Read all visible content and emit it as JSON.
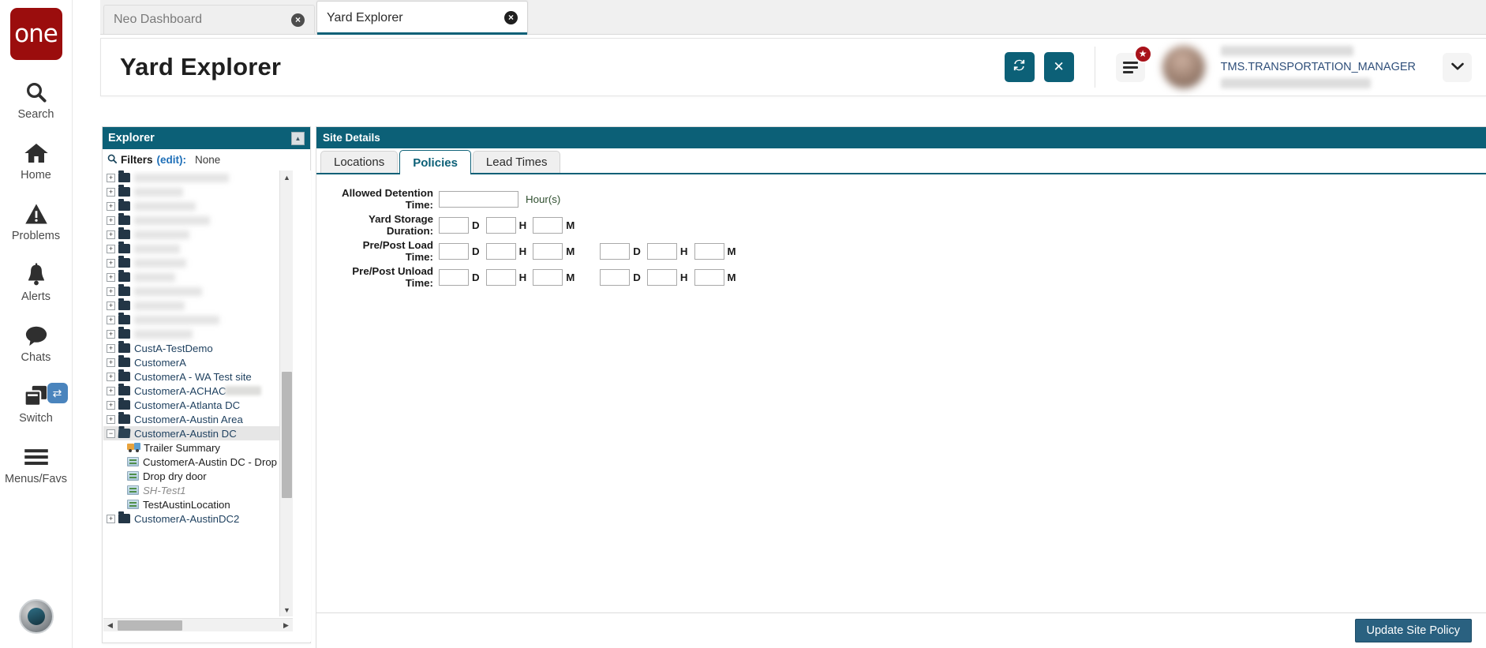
{
  "rail": {
    "logo_text": "one",
    "items": [
      {
        "label": "Search",
        "icon": "search-icon"
      },
      {
        "label": "Home",
        "icon": "home-icon"
      },
      {
        "label": "Problems",
        "icon": "warning-triangle-icon"
      },
      {
        "label": "Alerts",
        "icon": "bell-icon"
      },
      {
        "label": "Chats",
        "icon": "chat-bubble-icon"
      },
      {
        "label": "Switch",
        "icon": "switch-windows-icon",
        "badge_icon": "swap-arrows-icon"
      },
      {
        "label": "Menus/Favs",
        "icon": "hamburger-icon"
      }
    ]
  },
  "browser_tabs": [
    {
      "label": "Neo Dashboard",
      "active": false,
      "close_icon": "close-circle-icon"
    },
    {
      "label": "Yard Explorer",
      "active": true,
      "close_icon": "close-circle-icon"
    }
  ],
  "header": {
    "title": "Yard Explorer",
    "refresh_icon": "refresh-icon",
    "close_icon": "close-x-icon",
    "menu_icon": "hamburger-menu-icon",
    "star_badge_icon": "star-icon",
    "user_role": "TMS.TRANSPORTATION_MANAGER",
    "caret_icon": "chevron-down-icon",
    "accent_color": "#0c6077"
  },
  "explorer": {
    "title": "Explorer",
    "collapse_icon": "collapse-up-icon",
    "search_icon": "search-icon",
    "filters_label": "Filters",
    "filters_edit": "(edit):",
    "filters_value": "None",
    "tree": [
      {
        "label": "",
        "type": "folder",
        "state": "collapsed",
        "redacted": true,
        "redact_width": 120
      },
      {
        "label": "",
        "type": "folder",
        "state": "collapsed",
        "redacted": true,
        "redact_width": 62
      },
      {
        "label": "",
        "type": "folder",
        "state": "collapsed",
        "redacted": true,
        "redact_width": 78
      },
      {
        "label": "",
        "type": "folder",
        "state": "collapsed",
        "redacted": true,
        "redact_width": 96
      },
      {
        "label": "",
        "type": "folder",
        "state": "collapsed",
        "redacted": true,
        "redact_width": 70
      },
      {
        "label": "",
        "type": "folder",
        "state": "collapsed",
        "redacted": true,
        "redact_width": 58
      },
      {
        "label": "",
        "type": "folder",
        "state": "collapsed",
        "redacted": true,
        "redact_width": 66
      },
      {
        "label": "",
        "type": "folder",
        "state": "collapsed",
        "redacted": true,
        "redact_width": 52
      },
      {
        "label": "",
        "type": "folder",
        "state": "collapsed",
        "redacted": true,
        "redact_width": 86
      },
      {
        "label": "",
        "type": "folder",
        "state": "collapsed",
        "redacted": true,
        "redact_width": 64
      },
      {
        "label": "",
        "type": "folder",
        "state": "collapsed",
        "redacted": true,
        "redact_width": 108
      },
      {
        "label": "",
        "type": "folder",
        "state": "collapsed",
        "redacted": true,
        "redact_width": 74
      },
      {
        "label": "CustA-TestDemo",
        "type": "folder",
        "state": "collapsed"
      },
      {
        "label": "CustomerA",
        "type": "folder",
        "state": "collapsed"
      },
      {
        "label": "CustomerA - WA Test site",
        "type": "folder",
        "state": "collapsed"
      },
      {
        "label": "CustomerA-ACHAC",
        "type": "folder",
        "state": "collapsed",
        "partial_redact": true
      },
      {
        "label": "CustomerA-Atlanta DC",
        "type": "folder",
        "state": "collapsed"
      },
      {
        "label": "CustomerA-Austin Area",
        "type": "folder",
        "state": "collapsed"
      },
      {
        "label": "CustomerA-Austin DC",
        "type": "folder",
        "state": "expanded",
        "selected": true
      },
      {
        "label": "Trailer Summary",
        "type": "trailer",
        "child": true
      },
      {
        "label": "CustomerA-Austin DC - Drop",
        "type": "location",
        "child": true
      },
      {
        "label": "Drop dry door",
        "type": "location",
        "child": true
      },
      {
        "label": "SH-Test1",
        "type": "location",
        "child": true,
        "inactive": true
      },
      {
        "label": "TestAustinLocation",
        "type": "location",
        "child": true
      },
      {
        "label": "CustomerA-AustinDC2",
        "type": "folder",
        "state": "collapsed"
      }
    ],
    "scroll_up_icon": "triangle-up-icon",
    "scroll_down_icon": "triangle-down-icon",
    "scroll_left_icon": "triangle-left-icon",
    "scroll_right_icon": "triangle-right-icon"
  },
  "details": {
    "title": "Site Details",
    "tabs": [
      {
        "label": "Locations",
        "active": false
      },
      {
        "label": "Policies",
        "active": true
      },
      {
        "label": "Lead Times",
        "active": false
      }
    ],
    "form": {
      "allowed_detention": {
        "label": "Allowed Detention Time:",
        "value": "",
        "unit": "Hour(s)"
      },
      "yard_storage": {
        "label": "Yard Storage Duration:",
        "fields": [
          {
            "value": "",
            "unit": "D"
          },
          {
            "value": "",
            "unit": "H"
          },
          {
            "value": "",
            "unit": "M"
          }
        ]
      },
      "pre_post_load": {
        "label": "Pre/Post Load Time:",
        "pre": [
          {
            "value": "",
            "unit": "D"
          },
          {
            "value": "",
            "unit": "H"
          },
          {
            "value": "",
            "unit": "M"
          }
        ],
        "post": [
          {
            "value": "",
            "unit": "D"
          },
          {
            "value": "",
            "unit": "H"
          },
          {
            "value": "",
            "unit": "M"
          }
        ]
      },
      "pre_post_unload": {
        "label": "Pre/Post Unload Time:",
        "pre": [
          {
            "value": "",
            "unit": "D"
          },
          {
            "value": "",
            "unit": "H"
          },
          {
            "value": "",
            "unit": "M"
          }
        ],
        "post": [
          {
            "value": "",
            "unit": "D"
          },
          {
            "value": "",
            "unit": "H"
          },
          {
            "value": "",
            "unit": "M"
          }
        ]
      }
    }
  },
  "footer": {
    "update_button": "Update Site Policy"
  }
}
